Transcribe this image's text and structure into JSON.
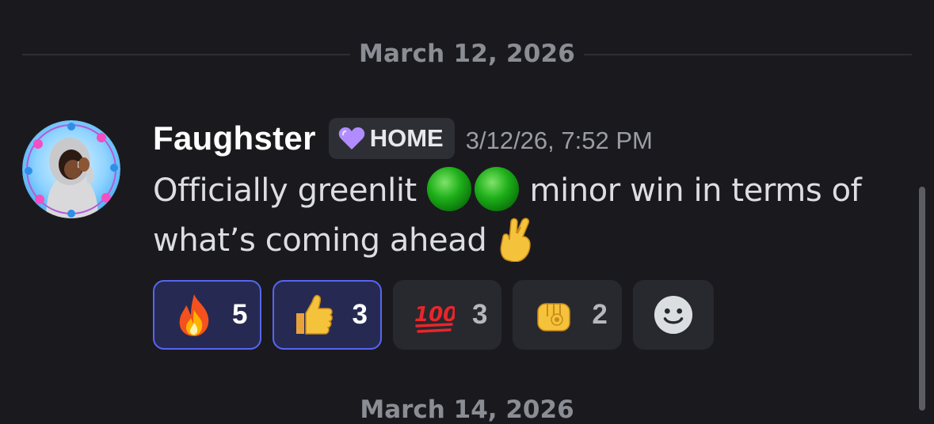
{
  "divider": {
    "date": "March 12, 2026"
  },
  "message": {
    "author": "Faughster",
    "tag": {
      "icon": "purple-heart-icon",
      "label": "HOME"
    },
    "timestamp": "3/12/26, 7:52 PM",
    "text_part1": "Officially greenlit",
    "text_part2": "minor win in terms of",
    "text_part3": "what’s coming ahead",
    "inline_emojis": [
      "green-circle-icon",
      "green-circle-icon",
      "crossed-fingers-icon"
    ]
  },
  "reactions": [
    {
      "emoji": "fire-icon",
      "count": "5",
      "active": true
    },
    {
      "emoji": "thumbs-up-icon",
      "count": "3",
      "active": true
    },
    {
      "emoji": "hundred-points-icon",
      "count": "3",
      "active": false
    },
    {
      "emoji": "pointing-fist-icon",
      "count": "2",
      "active": false
    }
  ],
  "add_reaction": {
    "icon": "add-reaction-smiley-icon"
  },
  "next_divider": {
    "date": "March 14, 2026"
  },
  "colors": {
    "background": "#1a1a1e",
    "active_reaction_border": "#5865f2",
    "active_reaction_bg": "#262a52",
    "tag_heart": "#b18cff"
  }
}
